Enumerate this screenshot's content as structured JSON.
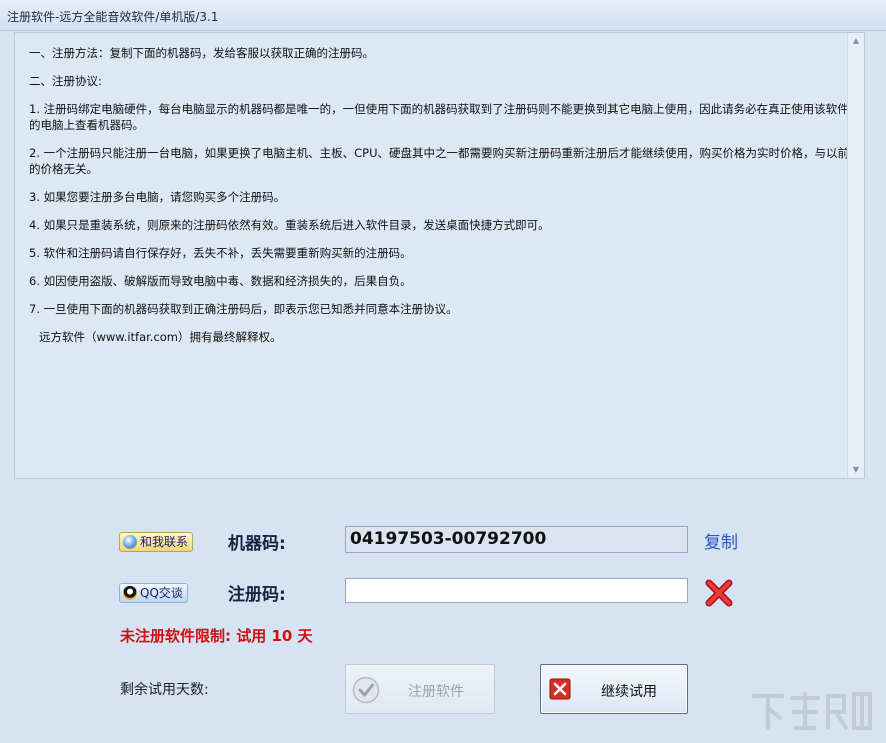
{
  "window": {
    "title": "注册软件-远方全能音效软件/单机版/3.1"
  },
  "agreement": {
    "paragraphs": [
      "一、注册方法：复制下面的机器码，发给客服以获取正确的注册码。",
      "二、注册协议:",
      "1. 注册码绑定电脑硬件，每台电脑显示的机器码都是唯一的，一但使用下面的机器码获取到了注册码则不能更换到其它电脑上使用，因此请务必在真正使用该软件的电脑上查看机器码。",
      "2. 一个注册码只能注册一台电脑，如果更换了电脑主机、主板、CPU、硬盘其中之一都需要购买新注册码重新注册后才能继续使用，购买价格为实时价格，与以前的价格无关。",
      "3. 如果您要注册多台电脑，请您购买多个注册码。",
      "4. 如果只是重装系统，则原来的注册码依然有效。重装系统后进入软件目录，发送桌面快捷方式即可。",
      "5. 软件和注册码请自行保存好，丢失不补，丢失需要重新购买新的注册码。",
      "6. 如因使用盗版、破解版而导致电脑中毒、数据和经济损失的，后果自负。",
      "7. 一旦使用下面的机器码获取到正确注册码后，即表示您已知悉并同意本注册协议。",
      "远方软件（www.itfar.com）拥有最终解释权。"
    ]
  },
  "contact": {
    "contact_label": "和我联系",
    "qq_label": "QQ交谈"
  },
  "machine": {
    "label": "机器码:",
    "code": "04197503-00792700",
    "copy_label": "复制"
  },
  "register": {
    "label": "注册码:",
    "value": ""
  },
  "trial": {
    "warning": "未注册软件限制: 试用  10  天",
    "remaining_label": "剩余试用天数:"
  },
  "buttons": {
    "register_label": "注册软件",
    "continue_label": "继续试用"
  },
  "icons": {
    "contact": "contact-icon",
    "qq": "qq-penguin-icon",
    "clear": "red-x-icon",
    "register": "checkmark-icon",
    "continue": "red-x-square-icon"
  },
  "colors": {
    "warning": "#cc1111",
    "link": "#2a56c6",
    "background": "#d6e3f2"
  }
}
